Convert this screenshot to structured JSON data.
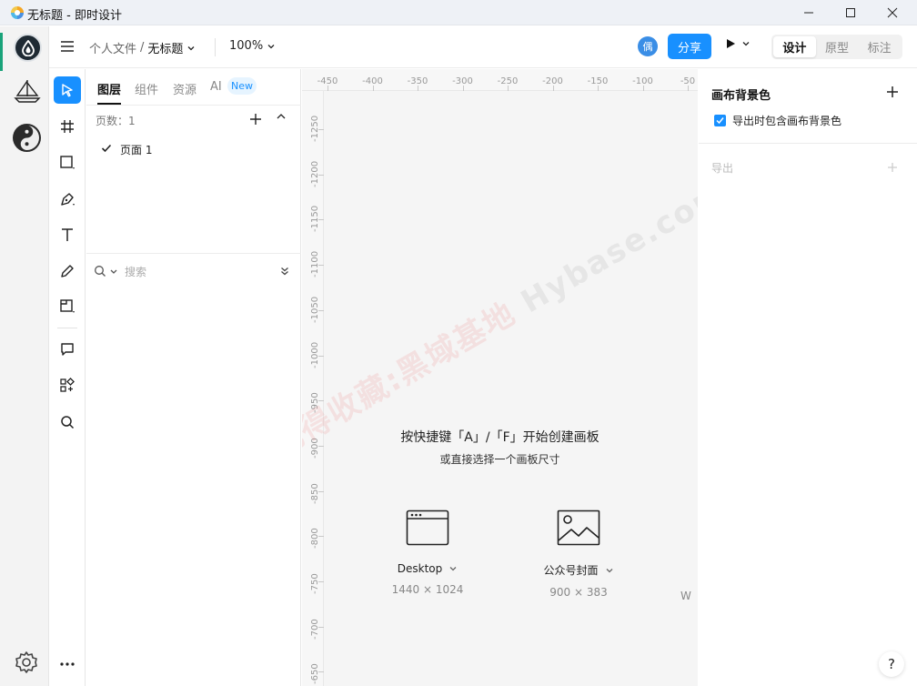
{
  "window": {
    "title": "无标题 - 即时设计",
    "minimize": "—",
    "maximize": "☐",
    "close": "✕"
  },
  "toolbar": {
    "breadcrumb_parent": "个人文件",
    "breadcrumb_sep": "/",
    "file_name": "无标题",
    "zoom": "100%",
    "avatar_text": "偶",
    "share_label": "分享",
    "modes": [
      "设计",
      "原型",
      "标注"
    ]
  },
  "left_panel": {
    "tabs": [
      "图层",
      "组件",
      "资源",
      "AI"
    ],
    "new_badge": "New",
    "page_count_label": "页数：1",
    "pages": [
      "页面 1"
    ],
    "search_placeholder": "搜索"
  },
  "canvas": {
    "ruler_top": [
      "-450",
      "-400",
      "-350",
      "-300",
      "-250",
      "-200",
      "-150",
      "-100",
      "-50"
    ],
    "ruler_left": [
      "-1250",
      "-1200",
      "-1150",
      "-1100",
      "-1050",
      "-1000",
      "-950",
      "-900",
      "-850",
      "-800",
      "-750",
      "-700",
      "-650"
    ],
    "empty_title": "按快捷键「A」/「F」开始创建画板",
    "empty_subtitle": "或直接选择一个画板尺寸",
    "presets": [
      {
        "name": "Desktop",
        "size": "1440 × 1024"
      },
      {
        "name": "公众号封面",
        "size": "900 × 383"
      }
    ],
    "partial_preset": "W",
    "watermark_cn": "记得收藏:黑域基地",
    "watermark_en": "Hybase.com"
  },
  "right_panel": {
    "bg_title": "画布背景色",
    "bg_checkbox_label": "导出时包含画布背景色",
    "export_title": "导出",
    "help": "?"
  },
  "colors": {
    "accent": "#1890ff",
    "brand_green": "#1aa37a"
  }
}
